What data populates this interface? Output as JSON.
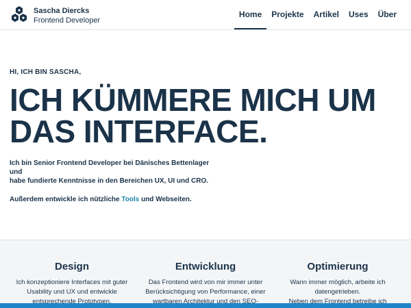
{
  "brand": {
    "name": "Sascha Diercks",
    "role": "Frontend Developer",
    "logo_icon": "hexagon-cluster-logo"
  },
  "nav": {
    "items": [
      {
        "label": "Home",
        "active": true
      },
      {
        "label": "Projekte",
        "active": false
      },
      {
        "label": "Artikel",
        "active": false
      },
      {
        "label": "Uses",
        "active": false
      },
      {
        "label": "Über",
        "active": false
      }
    ]
  },
  "hero": {
    "eyebrow": "HI, ICH BIN SASCHA,",
    "title_line1": "ICH KÜMMERE MICH UM",
    "title_line2": "DAS INTERFACE.",
    "intro_line1": "Ich bin Senior Frontend Developer bei Dänisches Bettenlager und",
    "intro_line2": "habe fundierte Kenntnisse in den Bereichen UX, UI und CRO.",
    "more_prefix": "Außerdem entwickle ich nützliche",
    "more_link": "Tools",
    "more_suffix": "und Webseiten."
  },
  "services": [
    {
      "title": "Design",
      "lines": [
        "Ich konzeptioniere Interfaces mit guter",
        "Usability und UX und entwickle",
        "entsprechende Prototypen."
      ]
    },
    {
      "title": "Entwicklung",
      "lines": [
        "Das Frontend wird von mir immer unter",
        "Berücksichtigung von Performance, einer",
        "wartbaren Architektur und den SEO-"
      ]
    },
    {
      "title": "Optimierung",
      "lines": [
        "Wann immer möglich, arbeite ich",
        "datengetrieben.",
        "Neben dem Frontend betreibe ich"
      ]
    }
  ],
  "colors": {
    "text": "#1b3349",
    "link": "#1e86ad",
    "accent_bar": "#1e86c9",
    "section_bg": "#f3f5f7"
  }
}
